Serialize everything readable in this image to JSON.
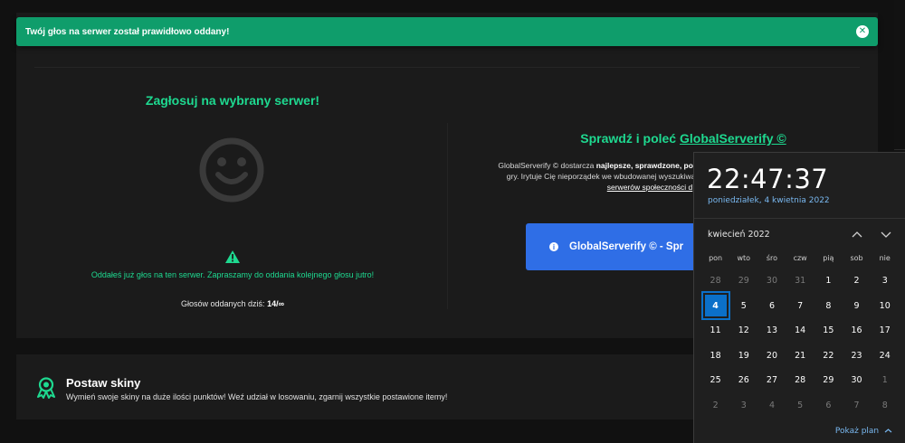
{
  "toast": {
    "message": "Twój głos na serwer został prawidłowo oddany!",
    "close_glyph": "✕"
  },
  "vote": {
    "title": "Zagłosuj na wybrany serwer!",
    "already_voted": "Oddałeś już głos na ten serwer. Zapraszamy do oddania kolejnego głosu jutro!",
    "votes_label": "Głosów oddanych dziś:",
    "votes_value": "14/∞",
    "icons": [
      "smiley-icon",
      "warning-icon"
    ]
  },
  "recommend": {
    "title_prefix": "Sprawdź i poleć",
    "title_link": "GlobalServerify ©",
    "desc_part1": "GlobalServerify © dostarcza ",
    "desc_bold": "najlepsze, sprawdzone, polskie i",
    "desc_part2": "gry. Irytuje Cię nieporządek we wbudowanej wyszukiwarce",
    "desc_link": "serwerów społeczności d",
    "button_label": "GlobalServerify © - Spr",
    "button_icon": "info-icon"
  },
  "skins": {
    "title": "Postaw skiny",
    "subtitle": "Wymień swoje skiny na duże ilości punktów! Weź udział w losowaniu, zgarnij wszystkie postawione itemy!",
    "icon": "award-ribbon-icon"
  },
  "calendar": {
    "time": "22:47:37",
    "date": "poniedziałek, 4 kwietnia 2022",
    "month": "kwiecień 2022",
    "weekdays": [
      "pon",
      "wto",
      "śro",
      "czw",
      "pią",
      "sob",
      "nie"
    ],
    "days": [
      {
        "d": "28",
        "other": true
      },
      {
        "d": "29",
        "other": true
      },
      {
        "d": "30",
        "other": true
      },
      {
        "d": "31",
        "other": true
      },
      {
        "d": "1"
      },
      {
        "d": "2"
      },
      {
        "d": "3"
      },
      {
        "d": "4",
        "today": true
      },
      {
        "d": "5"
      },
      {
        "d": "6"
      },
      {
        "d": "7"
      },
      {
        "d": "8"
      },
      {
        "d": "9"
      },
      {
        "d": "10"
      },
      {
        "d": "11"
      },
      {
        "d": "12"
      },
      {
        "d": "13"
      },
      {
        "d": "14"
      },
      {
        "d": "15"
      },
      {
        "d": "16"
      },
      {
        "d": "17"
      },
      {
        "d": "18"
      },
      {
        "d": "19"
      },
      {
        "d": "20"
      },
      {
        "d": "21"
      },
      {
        "d": "22"
      },
      {
        "d": "23"
      },
      {
        "d": "24"
      },
      {
        "d": "25"
      },
      {
        "d": "26"
      },
      {
        "d": "27"
      },
      {
        "d": "28"
      },
      {
        "d": "29"
      },
      {
        "d": "30"
      },
      {
        "d": "1",
        "other": true
      },
      {
        "d": "2",
        "other": true
      },
      {
        "d": "3",
        "other": true
      },
      {
        "d": "4",
        "other": true
      },
      {
        "d": "5",
        "other": true
      },
      {
        "d": "6",
        "other": true
      },
      {
        "d": "7",
        "other": true
      },
      {
        "d": "8",
        "other": true
      }
    ],
    "show_plan": "Pokaż plan",
    "colors": {
      "accent": "#0b70c9",
      "link": "#79b8f0"
    }
  },
  "colors": {
    "brand_green": "#1ed990",
    "toast_green": "#0f9d6b",
    "button_blue": "#2f6ee6",
    "panel_bg": "#1b1b1b"
  }
}
